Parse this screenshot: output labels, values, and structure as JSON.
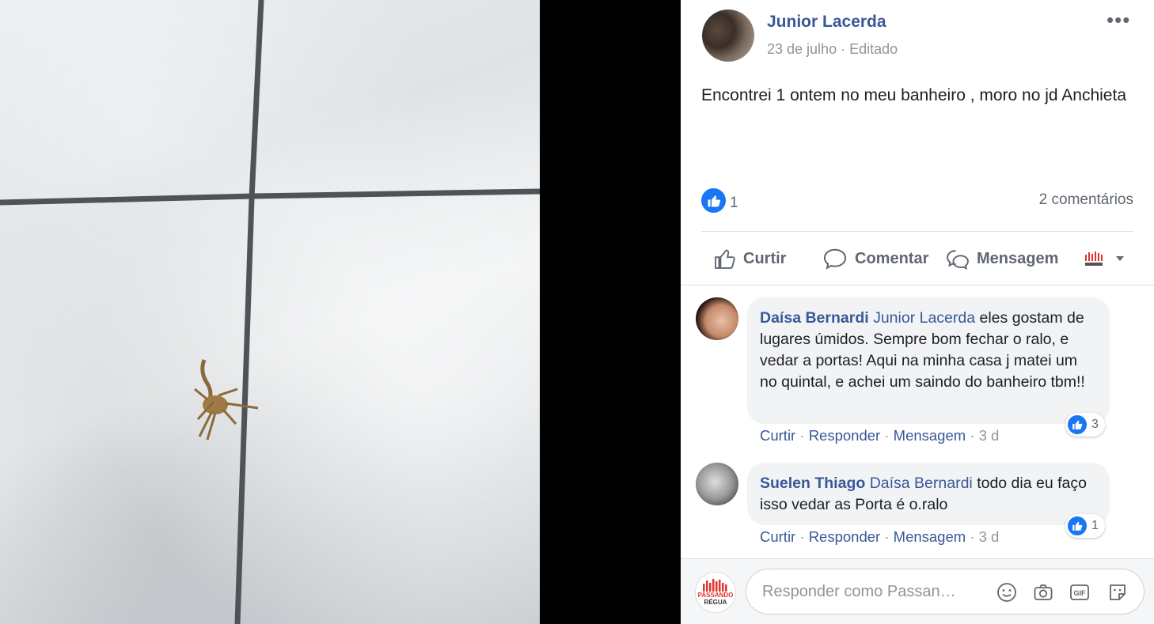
{
  "post": {
    "author": "Junior Lacerda",
    "date": "23 de julho",
    "edited": "Editado",
    "more_glyph": "•••",
    "text": "Encontrei 1 ontem no meu banheiro , moro no jd Anchieta",
    "like_count": "1",
    "comment_count": "2 comentários"
  },
  "actions": {
    "like": "Curtir",
    "comment": "Comentar",
    "message": "Mensagem"
  },
  "comments": [
    {
      "name": "Daísa Bernardi",
      "mention": "Junior Lacerda",
      "text": "eles gostam de lugares úmidos. Sempre bom fechar o ralo, e vedar a portas! Aqui na minha casa j matei um no quintal, e achei um saindo do banheiro tbm!!",
      "reactions": "3",
      "like": "Curtir",
      "reply": "Responder",
      "message": "Mensagem",
      "time": "3 d"
    },
    {
      "name": "Suelen Thiago",
      "mention": "Daísa Bernardi",
      "text": "todo dia eu faço isso vedar as Porta é o.ralo",
      "reactions": "1",
      "like": "Curtir",
      "reply": "Responder",
      "message": "Mensagem",
      "time": "3 d"
    }
  ],
  "reply": {
    "placeholder": "Responder como Passan…",
    "page_logo_line1": "PASSANDO",
    "page_logo_line2": "RÉGUA"
  },
  "colors": {
    "link": "#385898",
    "like_blue": "#1877f2",
    "muted": "#90949c"
  }
}
